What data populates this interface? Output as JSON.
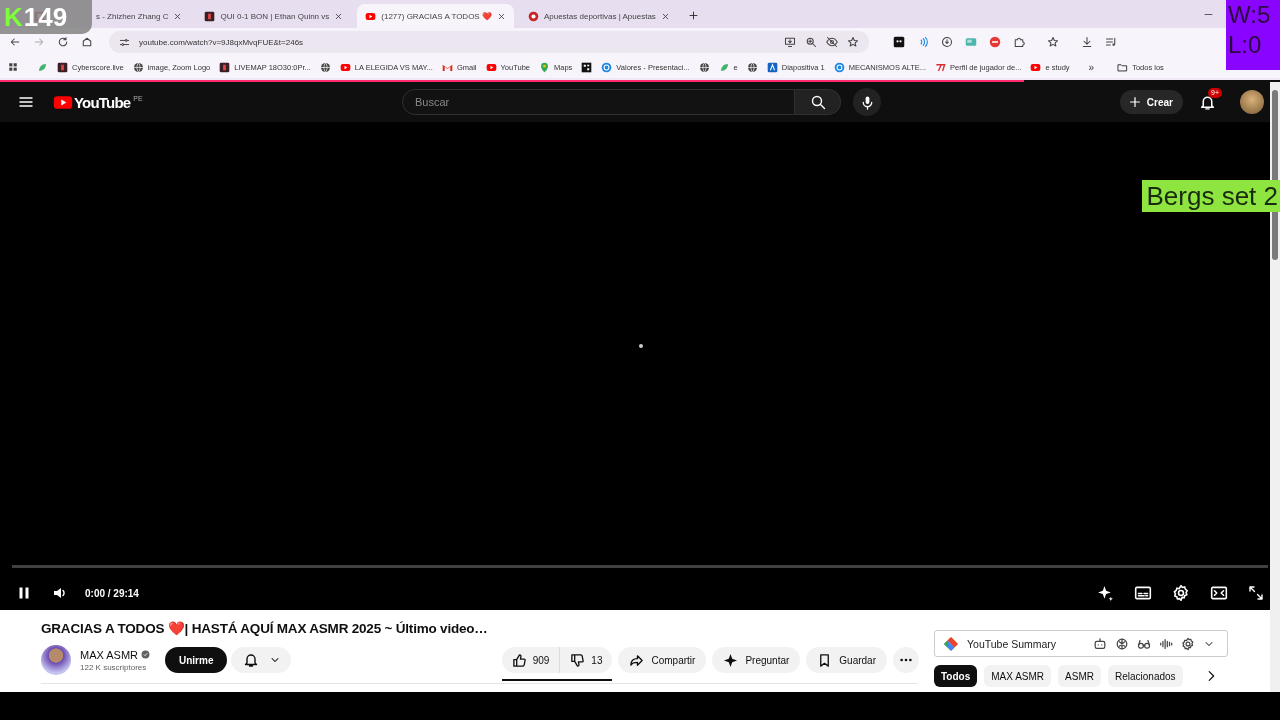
{
  "overlays": {
    "counter": {
      "letter": "K",
      "value": "149"
    },
    "record": [
      "W:5",
      "L:0"
    ],
    "label": "Bergs set 2"
  },
  "browser": {
    "tabs": [
      {
        "title": "s - Zhizhen Zhang C",
        "kind": "red-tile",
        "selected": false
      },
      {
        "title": "QUI 0-1 BON | Ethan Quinn vs",
        "kind": "dark-tile",
        "selected": false
      },
      {
        "title": "(1277) GRACIAS A TODOS ❤️",
        "kind": "youtube",
        "selected": true
      },
      {
        "title": "Apuestas deportivas | Apuestas",
        "kind": "red-circle",
        "selected": false
      }
    ],
    "address": "youtube.com/watch?v=9J8qxMvqFUE&t=246s",
    "bookmarks": [
      {
        "kind": "leaf"
      },
      {
        "kind": "dark-tile",
        "label": "Cyberscore.live"
      },
      {
        "kind": "globe",
        "label": "image, Zoom Logo"
      },
      {
        "kind": "dark-tile",
        "label": "LIVEMAP 18O30:0Pr..."
      },
      {
        "kind": "globe"
      },
      {
        "kind": "youtube",
        "label": "LA ELEGIDA VS MAY..."
      },
      {
        "kind": "gmail",
        "label": "Gmail"
      },
      {
        "kind": "youtube",
        "label": "YouTube"
      },
      {
        "kind": "pin",
        "label": "Maps"
      },
      {
        "kind": "grid-tile"
      },
      {
        "kind": "c-circle",
        "label": "Valores - Presentaci..."
      },
      {
        "kind": "globe"
      },
      {
        "kind": "leaf",
        "label": "e"
      },
      {
        "kind": "globe"
      },
      {
        "kind": "a-tile",
        "label": "Diapositiva 1"
      },
      {
        "kind": "c-circle",
        "label": "MECANISMOS ALTE..."
      },
      {
        "kind": "tv",
        "label": "Perfil de jugador de..."
      },
      {
        "kind": "youtube",
        "label": "e study"
      }
    ],
    "more_bookmarks": "»",
    "all_bookmarks": "Todos los",
    "page_loading": {
      "level": 0.8
    }
  },
  "youtube": {
    "logo": "YouTube",
    "region": "PE",
    "search": {
      "placeholder": "Buscar"
    },
    "create": "Crear",
    "notifications": "9+",
    "player": {
      "playing": true,
      "time": "0:00 / 29:14",
      "progress": {
        "level": 0
      }
    },
    "video": {
      "title": "GRACIAS A TODOS ❤️| HASTÁ AQUÍ MAX ASMR 2025 ~ Último video…",
      "channel": "MAX ASMR",
      "verified": true,
      "subscribers": "122 K suscriptores",
      "join": "Unirme",
      "likes": "909",
      "dislikes": "13",
      "share": "Compartir",
      "ask": "Preguntar",
      "save": "Guardar"
    },
    "summary": {
      "title": "YouTube Summary"
    },
    "chips": [
      {
        "label": "Todos",
        "selected": true
      },
      {
        "label": "MAX ASMR",
        "selected": false
      },
      {
        "label": "ASMR",
        "selected": false
      },
      {
        "label": "Relacionados",
        "selected": false
      }
    ]
  }
}
